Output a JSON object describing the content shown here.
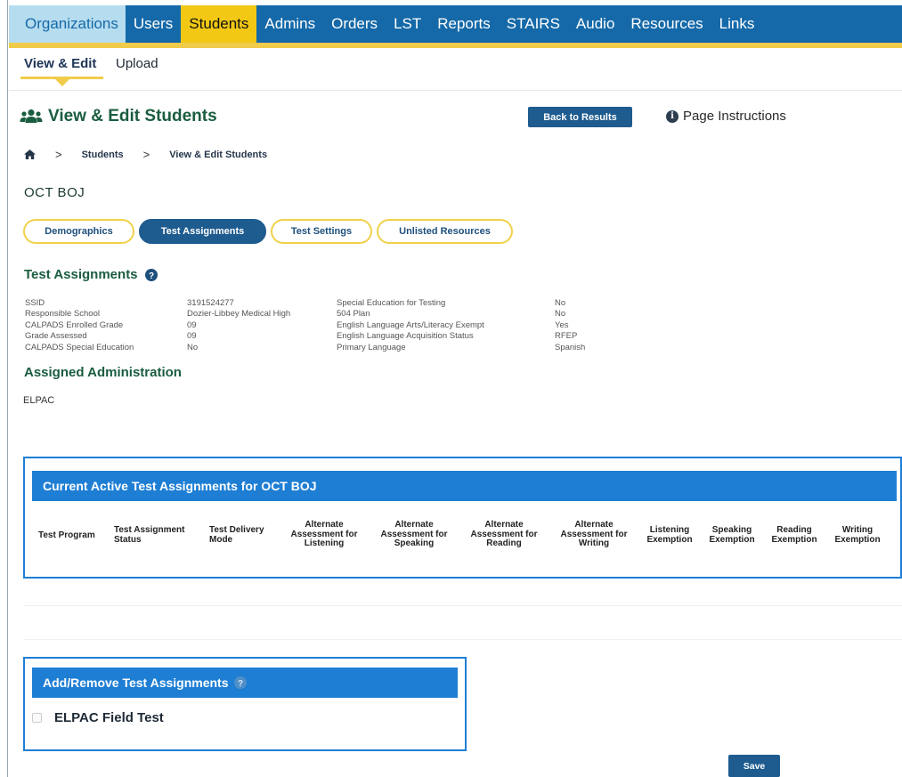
{
  "topnav": {
    "items": [
      "Organizations",
      "Users",
      "Students",
      "Admins",
      "Orders",
      "LST",
      "Reports",
      "STAIRS",
      "Audio",
      "Resources",
      "Links"
    ]
  },
  "subnav": {
    "view_edit": "View & Edit",
    "upload": "Upload"
  },
  "page": {
    "title": "View & Edit Students",
    "back_button": "Back to Results",
    "instructions": "Page Instructions"
  },
  "breadcrumb": {
    "home_icon": "home-icon",
    "items": [
      "Students",
      "View & Edit Students"
    ]
  },
  "student": {
    "name": "OCT BOJ"
  },
  "tabs": [
    "Demographics",
    "Test Assignments",
    "Test Settings",
    "Unlisted Resources"
  ],
  "test_assignments": {
    "title": "Test Assignments",
    "left_labels": [
      "SSID",
      "Responsible School",
      "CALPADS Enrolled Grade",
      "Grade Assessed",
      "CALPADS Special Education"
    ],
    "left_values": [
      "3191524277",
      "Dozier-Libbey Medical High",
      "09",
      "09",
      "No"
    ],
    "right_labels": [
      "Special Education for Testing",
      "504 Plan",
      "English Language Arts/Literacy Exempt",
      "English Language Acquisition Status",
      "Primary Language"
    ],
    "right_values": [
      "No",
      "No",
      "Yes",
      "RFEP",
      "Spanish"
    ]
  },
  "assigned_admin": {
    "title": "Assigned Administration",
    "value": "ELPAC"
  },
  "active_assignments": {
    "title": "Current Active Test Assignments for OCT BOJ",
    "columns": [
      {
        "l1": "Test Program",
        "l2": "",
        "l3": ""
      },
      {
        "l1": "Test Assignment",
        "l2": "Status",
        "l3": ""
      },
      {
        "l1": "Test Delivery",
        "l2": "Mode",
        "l3": ""
      },
      {
        "l1": "Alternate",
        "l2": "Assessment for",
        "l3": "Listening"
      },
      {
        "l1": "Alternate",
        "l2": "Assessment for",
        "l3": "Speaking"
      },
      {
        "l1": "Alternate",
        "l2": "Assessment for",
        "l3": "Reading"
      },
      {
        "l1": "Alternate",
        "l2": "Assessment for",
        "l3": "Writing"
      },
      {
        "l1": "Listening",
        "l2": "Exemption",
        "l3": ""
      },
      {
        "l1": "Speaking",
        "l2": "Exemption",
        "l3": ""
      },
      {
        "l1": "Reading",
        "l2": "Exemption",
        "l3": ""
      },
      {
        "l1": "Writing",
        "l2": "Exemption",
        "l3": ""
      }
    ]
  },
  "add_remove": {
    "title": "Add/Remove Test Assignments",
    "option": "ELPAC Field Test"
  },
  "save_button": "Save",
  "colors": {
    "nav_blue": "#1569a8",
    "nav_active": "#f2c815",
    "heading_green": "#1a5d3f",
    "button_blue": "#1e5b8e",
    "box_blue": "#1e7ed4",
    "tab_border": "#f0d14a"
  }
}
